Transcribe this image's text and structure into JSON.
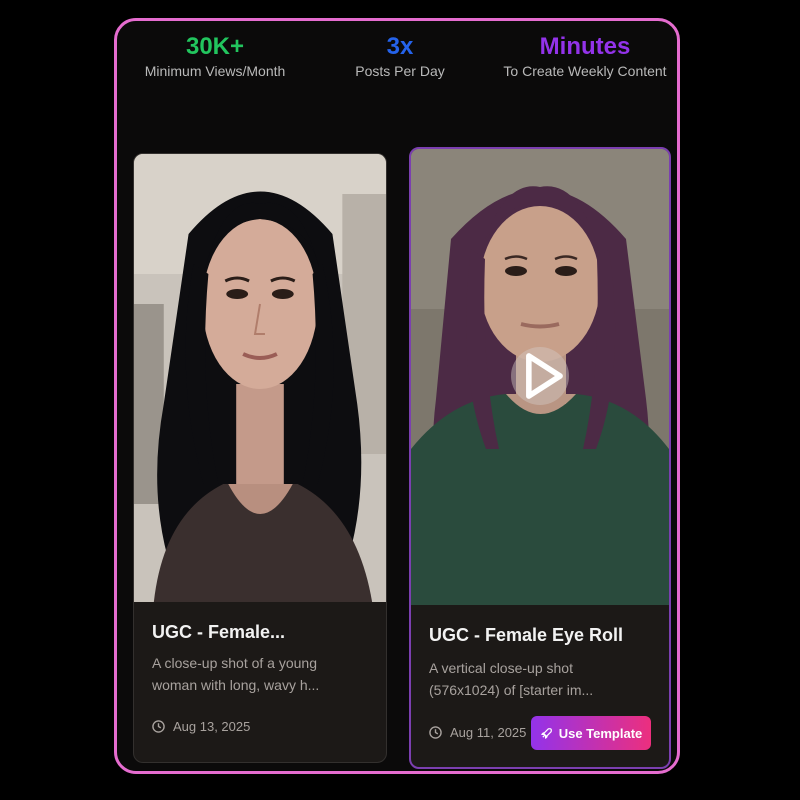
{
  "stats": [
    {
      "value": "30K+",
      "label": "Minimum Views/Month",
      "color": "#22c55e"
    },
    {
      "value": "3x",
      "label": "Posts Per Day",
      "color": "#2563eb"
    },
    {
      "value": "Minutes",
      "label": "To Create Weekly Content",
      "color": "#9333ea"
    }
  ],
  "cards": [
    {
      "title": "UGC - Female...",
      "description": "A close-up shot of a young woman with long, wavy h...",
      "date": "Aug 13, 2025",
      "thumbnail": "portrait-black-hair"
    },
    {
      "title": "UGC - Female Eye Roll",
      "description": "A vertical close-up shot (576x1024) of [starter im...",
      "date": "Aug 11, 2025",
      "thumbnail": "portrait-purple-hair",
      "button_label": "Use Template",
      "button_icon": "rocket-icon",
      "play_icon": "play-icon"
    }
  ],
  "colors": {
    "frame_border": "#e56ccf",
    "card_bg": "#1c1917",
    "selected_border": "#7b3fb0"
  }
}
